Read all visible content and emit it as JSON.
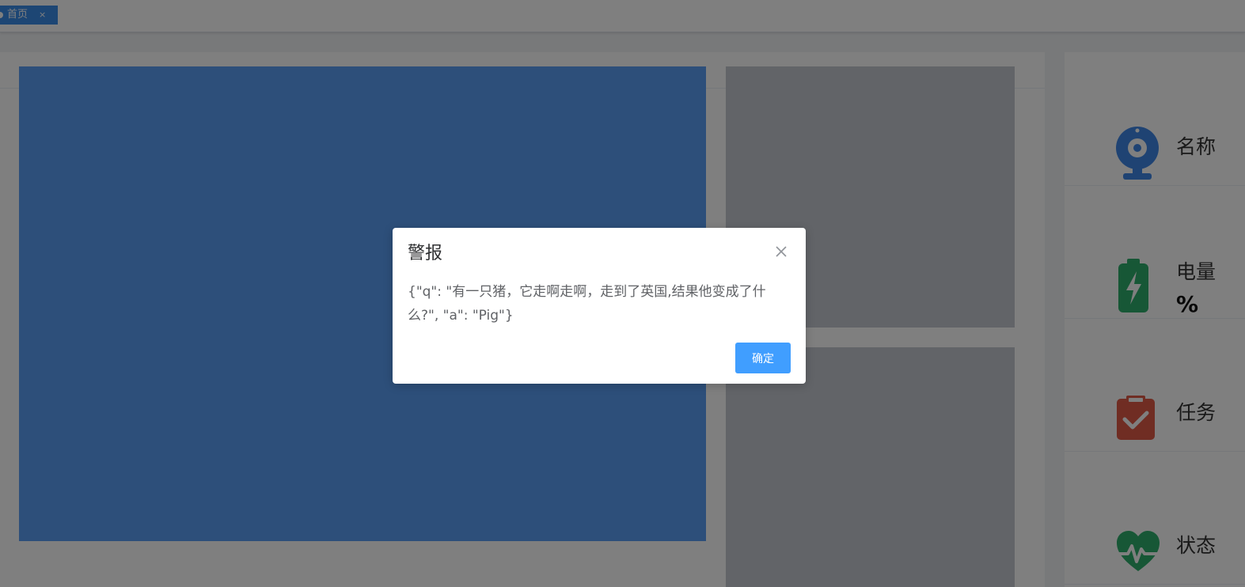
{
  "tabs": [
    {
      "label": "首页",
      "close": "×",
      "active": true
    }
  ],
  "info": {
    "name_label": "名称",
    "battery_label": "电量",
    "battery_value": "%",
    "task_label": "任务",
    "status_label": "状态"
  },
  "dialog": {
    "title": "警报",
    "message": "{\"q\": \"有一只猪，它走啊走啊，走到了英国,结果他变成了什么?\", \"a\": \"Pig\"}",
    "confirm_label": "确定"
  },
  "colors": {
    "accent": "#409eff",
    "tab_active": "#3b8ce8",
    "video_main": "#5b9ef4",
    "camera_icon": "#3f86e6",
    "battery_icon": "#2fae6c",
    "task_icon": "#e05a47",
    "status_icon": "#2fae6c"
  },
  "icons": {
    "name": "camera-icon",
    "battery": "battery-charging-icon",
    "task": "clipboard-check-icon",
    "status": "heart-pulse-icon",
    "close": "close-icon"
  }
}
